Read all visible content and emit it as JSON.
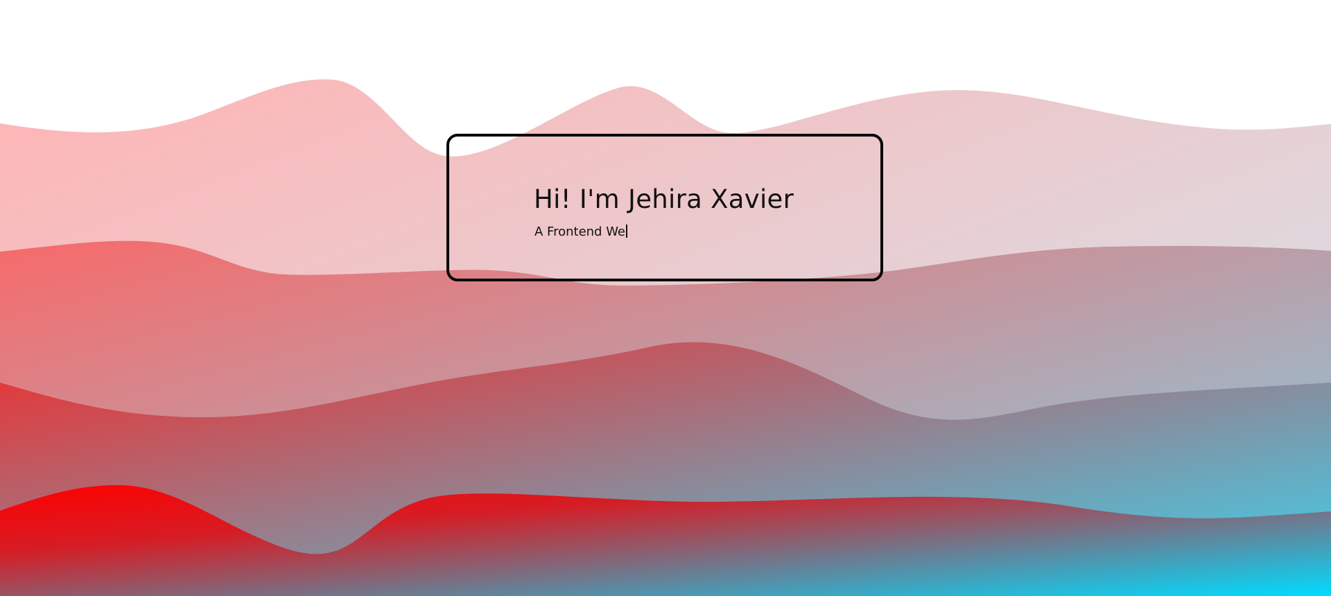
{
  "hero": {
    "title": "Hi! I'm Jehira Xavier",
    "subtitle": "A Frontend We"
  },
  "colors": {
    "background": "#ffffff",
    "wave_warm": "#ff0000",
    "wave_cool": "#00dcff",
    "card_border": "#000000",
    "text": "#111111"
  },
  "icons": {
    "cursor": "text-caret-icon"
  }
}
